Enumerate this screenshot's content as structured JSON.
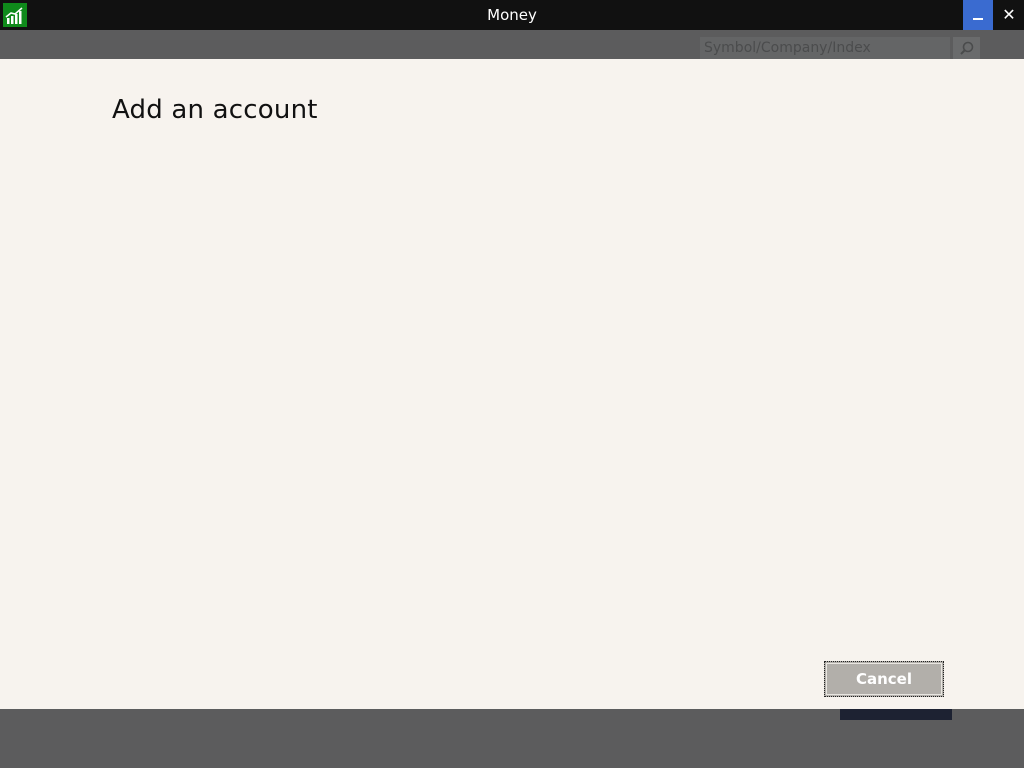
{
  "window": {
    "title": "Money",
    "app_icon": "finance-chart-icon",
    "minimize_icon": "minimize-icon",
    "close_icon": "close-icon",
    "close_glyph": "✕"
  },
  "background_app": {
    "search": {
      "placeholder": "Symbol/Company/Index",
      "button_icon": "search-icon"
    }
  },
  "dialog": {
    "title": "Add an account",
    "cancel_label": "Cancel"
  },
  "colors": {
    "titlebar": "#111111",
    "app_icon_bg": "#0f8a1b",
    "minimize_accent": "#3a6bd0",
    "dialog_bg": "#f7f3ee",
    "backdrop": "#5c5c5d",
    "cancel_button": "#b2afaa"
  }
}
